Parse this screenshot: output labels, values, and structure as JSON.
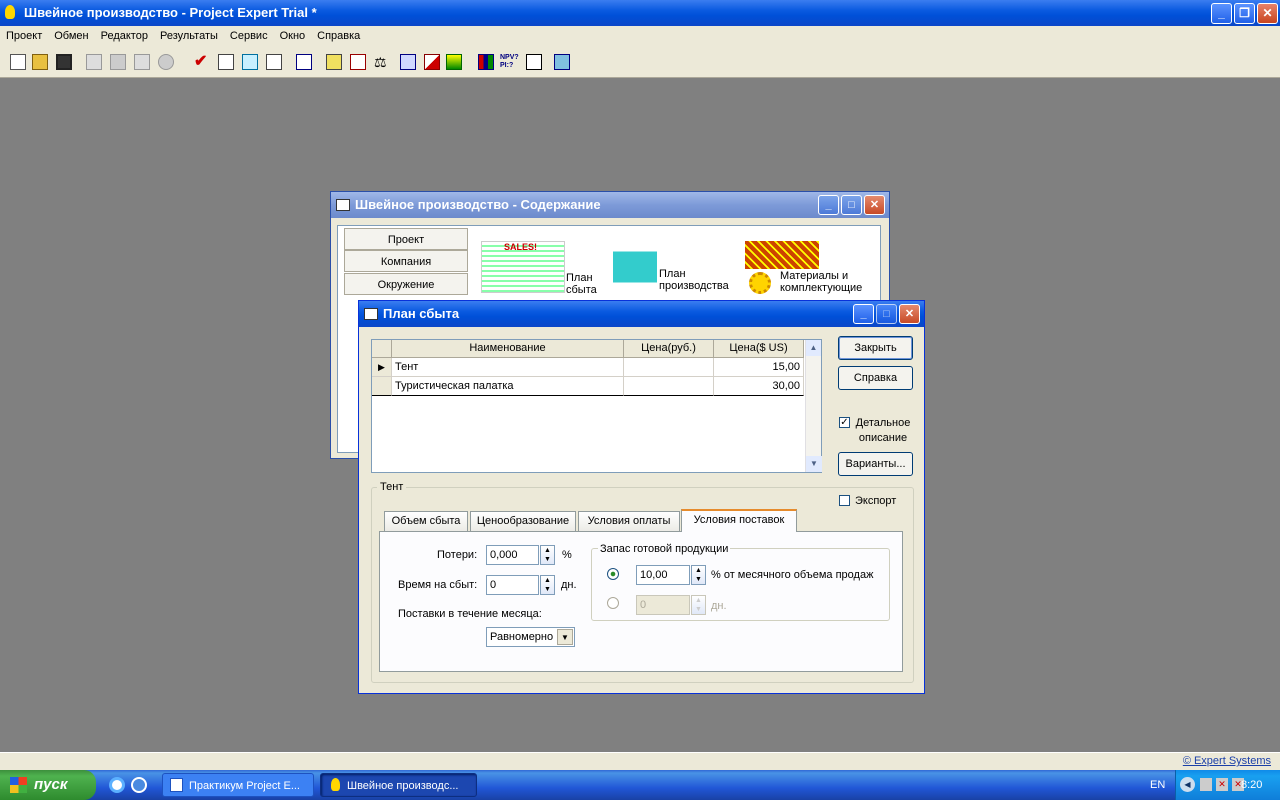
{
  "app": {
    "title": "Швейное производство - Project Expert Trial *"
  },
  "menu": [
    "Проект",
    "Обмен",
    "Редактор",
    "Результаты",
    "Сервис",
    "Окно",
    "Справка"
  ],
  "toolbar_icons": [
    "new-icon",
    "open-icon",
    "save-icon",
    "preview-icon",
    "print-icon",
    "word-icon",
    "export-icon",
    "check-icon",
    "checklist-icon",
    "calc-icon",
    "report-icon",
    "table-icon",
    "cashflow-icon",
    "balance-icon",
    "chart-icon",
    "graph-icon",
    "areachart-icon",
    "bars-icon",
    "npv-icon",
    "analysis-icon",
    "grid-icon"
  ],
  "content_window": {
    "title": "Швейное производство - Содержание",
    "sections": [
      "Проект",
      "Компания",
      "Окружение"
    ],
    "modules": [
      {
        "label": "План сбыта",
        "icon": "sales-icon"
      },
      {
        "label": "План производства",
        "icon": "factory-icon"
      },
      {
        "label": "Материалы и комплектующие",
        "icon": "materials-icon"
      }
    ]
  },
  "sales_window": {
    "title": "План сбыта",
    "columns": [
      "Наименование",
      "Цена(руб.)",
      "Цена($ US)"
    ],
    "rows": [
      {
        "name": "Тент",
        "price_rub": "",
        "price_usd": "15,00"
      },
      {
        "name": "Туристическая палатка",
        "price_rub": "",
        "price_usd": "30,00"
      }
    ],
    "buttons": {
      "close": "Закрыть",
      "help": "Справка",
      "variants": "Варианты..."
    },
    "detailed_description": {
      "label": "Детальное описание",
      "checked": true
    },
    "group_label": "Тент",
    "export": {
      "label": "Экспорт",
      "checked": false
    },
    "tabs": [
      "Объем сбыта",
      "Ценообразование",
      "Условия оплаты",
      "Условия поставок"
    ],
    "active_tab": "Условия поставок",
    "losses": {
      "label": "Потери:",
      "value": "0,000",
      "unit": "%"
    },
    "sale_time": {
      "label": "Время на сбыт:",
      "value": "0",
      "unit": "дн."
    },
    "deliveries": {
      "label": "Поставки в течение месяца:",
      "value": "Равномерно"
    },
    "stock": {
      "label": "Запас готовой продукции",
      "percent_value": "10,00",
      "percent_label": "% от месячного объема продаж",
      "days_value": "0",
      "days_label": "дн."
    }
  },
  "statusbar": {
    "copyright": "© Expert Systems"
  },
  "taskbar": {
    "start": "пуск",
    "tasks": [
      "Практикум Project E...",
      "Швейное производс..."
    ],
    "lang": "EN",
    "time": "8:20"
  }
}
